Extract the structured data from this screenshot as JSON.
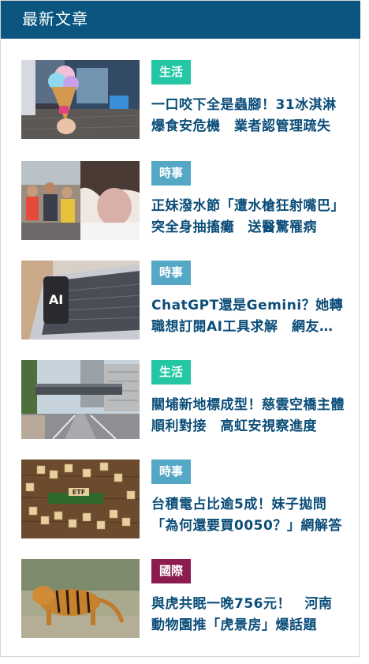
{
  "header": {
    "title": "最新文章"
  },
  "colors": {
    "header_bg": "#0a5680",
    "title_text": "#0b4d78",
    "tag_life": "#24c6a4",
    "tag_current": "#54a8c6",
    "tag_intl": "#8c1c4f"
  },
  "articles": [
    {
      "category": "生活",
      "category_color": "#24c6a4",
      "title": "一口咬下全是蟲腳！31冰淇淋爆食安危機　業者認管理疏失",
      "thumbnail": "ice-cream-cone-photo"
    },
    {
      "category": "時事",
      "category_color": "#54a8c6",
      "title": "正妹潑水節「遭水槍狂射嘴巴」突全身抽搐癱　送醫驚罹病",
      "thumbnail": "water-festival-photo"
    },
    {
      "category": "時事",
      "category_color": "#54a8c6",
      "title": "ChatGPT還是Gemini？她轉職想訂閱AI工具求解　網友建議",
      "thumbnail": "laptop-ai-phone-photo"
    },
    {
      "category": "生活",
      "category_color": "#24c6a4",
      "title": "關埔新地標成型！慈雲空橋主體順利對接　高虹安視察進度",
      "thumbnail": "sky-bridge-photo"
    },
    {
      "category": "時事",
      "category_color": "#54a8c6",
      "title": "台積電占比逾5成！妹子拋問「為何還要買0050？」網解答",
      "thumbnail": "letter-tiles-etf-photo"
    },
    {
      "category": "國際",
      "category_color": "#8c1c4f",
      "title": "與虎共眠一晚756元！　河南動物園推「虎景房」爆話題",
      "thumbnail": "tiger-photo"
    }
  ]
}
